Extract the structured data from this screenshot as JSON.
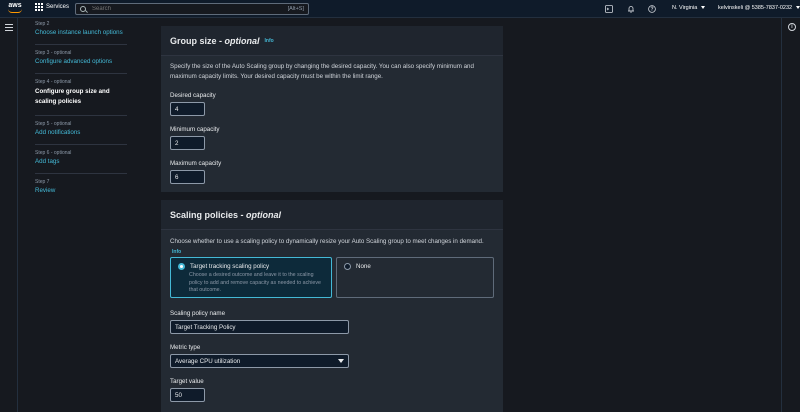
{
  "topnav": {
    "logo": "aws",
    "services_label": "Services",
    "search_placeholder": "Search",
    "search_shortcut": "[Alt+S]",
    "region": "N. Virginia",
    "account": "kelvinskeli @ 5385-7837-0232"
  },
  "steps": [
    {
      "num": "Step 2",
      "label": "Choose instance launch options",
      "state": "link"
    },
    {
      "num": "Step 3 - optional",
      "label": "Configure advanced options",
      "state": "link"
    },
    {
      "num": "Step 4 - optional",
      "label": "Configure group size and scaling policies",
      "state": "current"
    },
    {
      "num": "Step 5 - optional",
      "label": "Add notifications",
      "state": "link"
    },
    {
      "num": "Step 6 - optional",
      "label": "Add tags",
      "state": "link"
    },
    {
      "num": "Step 7",
      "label": "Review",
      "state": "link"
    }
  ],
  "group_size": {
    "title": "Group size - ",
    "title_italic": "optional",
    "info": "Info",
    "description": "Specify the size of the Auto Scaling group by changing the desired capacity. You can also specify minimum and maximum capacity limits. Your desired capacity must be within the limit range.",
    "desired_label": "Desired capacity",
    "desired_value": "4",
    "min_label": "Minimum capacity",
    "min_value": "2",
    "max_label": "Maximum capacity",
    "max_value": "6"
  },
  "scaling": {
    "title": "Scaling policies - ",
    "title_italic": "optional",
    "description": "Choose whether to use a scaling policy to dynamically resize your Auto Scaling group to meet changes in demand.",
    "info": "Info",
    "option_target_label": "Target tracking scaling policy",
    "option_target_desc": "Choose a desired outcome and leave it to the scaling policy to add and remove capacity as needed to achieve that outcome.",
    "option_none_label": "None",
    "selected": "target",
    "policy_name_label": "Scaling policy name",
    "policy_name_value": "Target Tracking Policy",
    "metric_label": "Metric type",
    "metric_value": "Average CPU utilization",
    "target_label": "Target value",
    "target_value": "50"
  },
  "colors": {
    "accent": "#44b9d6",
    "background": "#16191f",
    "panel": "#232a33",
    "aws_orange": "#ff9900"
  }
}
